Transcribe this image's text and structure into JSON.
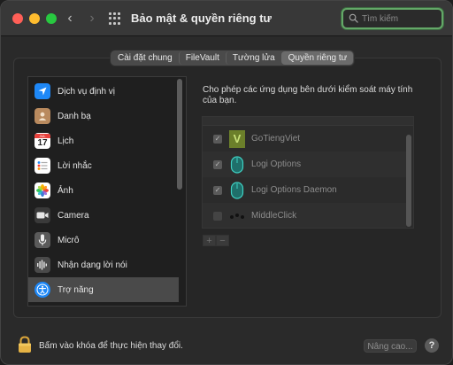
{
  "window": {
    "title": "Bảo mật & quyền riêng tư",
    "back_glyph": "‹",
    "forward_glyph": "›"
  },
  "search": {
    "placeholder": "Tìm kiếm",
    "value": ""
  },
  "tabs": [
    {
      "label": "Cài đặt chung",
      "active": false
    },
    {
      "label": "FileVault",
      "active": false
    },
    {
      "label": "Tường lửa",
      "active": false
    },
    {
      "label": "Quyền riêng tư",
      "active": true
    }
  ],
  "sidebar": {
    "items": [
      {
        "label": "Dịch vụ định vị",
        "icon": "location-icon",
        "color": "#1e88f7"
      },
      {
        "label": "Danh bạ",
        "icon": "contacts-icon",
        "color": "#b98a5e"
      },
      {
        "label": "Lịch",
        "icon": "calendar-icon",
        "color": "#ffffff",
        "calendar_month": "JUL",
        "calendar_day": "17"
      },
      {
        "label": "Lời nhắc",
        "icon": "reminders-icon",
        "color": "#ffffff"
      },
      {
        "label": "Ảnh",
        "icon": "photos-icon",
        "color": "#ffffff"
      },
      {
        "label": "Camera",
        "icon": "camera-icon",
        "color": "#3a3a3a"
      },
      {
        "label": "Micrô",
        "icon": "microphone-icon",
        "color": "#5a5a5a"
      },
      {
        "label": "Nhận dạng lời nói",
        "icon": "speech-recognition-icon",
        "color": "#4a4a4a"
      },
      {
        "label": "Trợ năng",
        "icon": "accessibility-icon",
        "color": "#1e88f7",
        "selected": true
      }
    ]
  },
  "main": {
    "description": "Cho phép các ứng dụng bên dưới kiểm soát máy tính của bạn.",
    "apps": [
      {
        "name": "GoTiengViet",
        "checked": true,
        "icon": "gotiengviet-icon",
        "icon_letter": "V",
        "color": "#8aa33b"
      },
      {
        "name": "Logi Options",
        "checked": true,
        "icon": "logi-options-icon",
        "color": "#2ec4b6"
      },
      {
        "name": "Logi Options Daemon",
        "checked": true,
        "icon": "logi-options-daemon-icon",
        "color": "#2ec4b6"
      },
      {
        "name": "MiddleClick",
        "checked": false,
        "icon": "middleclick-icon",
        "color": "#111111"
      }
    ],
    "add_label": "+",
    "remove_label": "−"
  },
  "footer": {
    "lock_text": "Bấm vào khóa để thực hiện thay đổi.",
    "advanced_label": "Nâng cao...",
    "help_label": "?"
  }
}
